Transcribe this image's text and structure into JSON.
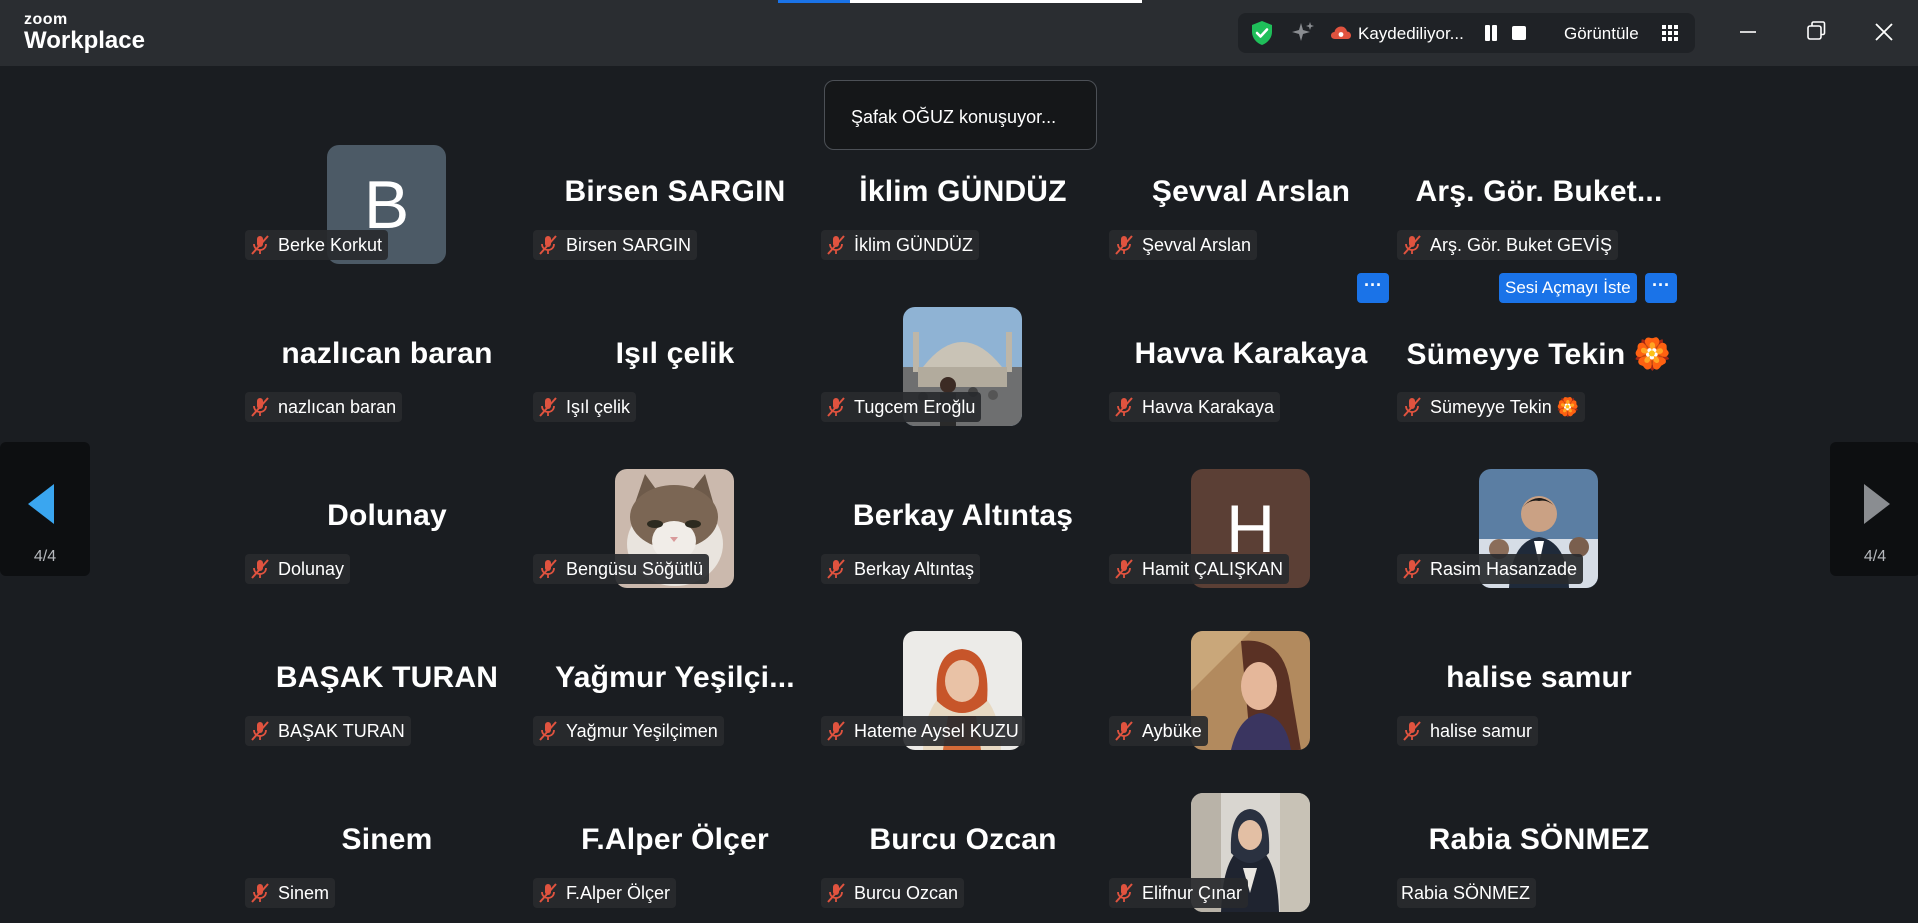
{
  "app": {
    "logo_top": "zoom",
    "logo_bottom": "Workplace"
  },
  "toolbar": {
    "recording_text": "Kaydediliyor...",
    "view_label": "Görüntüle"
  },
  "speaking_banner": "Şafak OĞUZ konuşuyor...",
  "tiles": [
    {
      "display": "",
      "label": "Berke Korkut",
      "avatar": "letter",
      "letter": "B",
      "color": "#4c5a66",
      "muted": true
    },
    {
      "display": "Birsen SARGIN",
      "label": "Birsen SARGIN",
      "avatar": "none",
      "muted": true
    },
    {
      "display": "İklim GÜNDÜZ",
      "label": "İklim GÜNDÜZ",
      "avatar": "none",
      "muted": true
    },
    {
      "display": "Şevval Arslan",
      "label": "Şevval Arslan",
      "avatar": "none",
      "muted": true
    },
    {
      "display": "Arş. Gör. Buket...",
      "label": "Arş. Gör. Buket GEVİŞ",
      "avatar": "none",
      "muted": true
    },
    {
      "display": "nazlıcan baran",
      "label": "nazlıcan baran",
      "avatar": "none",
      "muted": true
    },
    {
      "display": "Işıl çelik",
      "label": "Işıl çelik",
      "avatar": "none",
      "muted": true
    },
    {
      "display": "",
      "label": "Tugcem Eroğlu",
      "avatar": "photo-mosque",
      "muted": true
    },
    {
      "display": "Havva Karakaya",
      "label": "Havva Karakaya",
      "avatar": "none",
      "muted": true
    },
    {
      "display": "Sümeyye  Tekin 🏵️",
      "label": "Sümeyye Tekin 🏵️",
      "avatar": "none",
      "muted": true
    },
    {
      "display": "Dolunay",
      "label": "Dolunay",
      "avatar": "none",
      "muted": true
    },
    {
      "display": "",
      "label": "Bengüsu Söğütlü",
      "avatar": "photo-cat",
      "muted": true
    },
    {
      "display": "Berkay Altıntaş",
      "label": "Berkay Altıntaş",
      "avatar": "none",
      "muted": true
    },
    {
      "display": "",
      "label": "Hamit ÇALIŞKAN",
      "avatar": "letter",
      "letter": "H",
      "color": "#5b3f35",
      "muted": true
    },
    {
      "display": "",
      "label": "Rasim Hasanzade",
      "avatar": "photo-man",
      "muted": true
    },
    {
      "display": "BAŞAK TURAN",
      "label": "BAŞAK TURAN",
      "avatar": "none",
      "muted": true
    },
    {
      "display": "Yağmur  Yeşilçi...",
      "label": "Yağmur Yeşilçimen",
      "avatar": "none",
      "muted": true
    },
    {
      "display": "",
      "label": "Hateme Aysel KUZU",
      "avatar": "photo-hijab",
      "muted": true
    },
    {
      "display": "",
      "label": "Aybüke",
      "avatar": "photo-girl",
      "muted": true
    },
    {
      "display": "halise samur",
      "label": "halise samur",
      "avatar": "none",
      "muted": true
    },
    {
      "display": "Sinem",
      "label": "Sinem",
      "avatar": "none",
      "muted": true
    },
    {
      "display": "F.Alper Ölçer",
      "label": "F.Alper Ölçer",
      "avatar": "none",
      "muted": true
    },
    {
      "display": "Burcu Ozcan",
      "label": "Burcu Ozcan",
      "avatar": "none",
      "muted": true
    },
    {
      "display": "",
      "label": "Elifnur Çınar",
      "avatar": "photo-hijab2",
      "muted": true
    },
    {
      "display": "Rabia SÖNMEZ",
      "label": "Rabia SÖNMEZ",
      "avatar": "none",
      "muted": false
    }
  ],
  "buttons": {
    "more": "···",
    "ask_unmute": "Sesi Açmayı İste"
  },
  "pager": {
    "left": "4/4",
    "right": "4/4"
  },
  "colors": {
    "accent": "#1a73e8",
    "mute_red": "#e0533f",
    "shield": "#1fbf5a",
    "cloud": "#e0533f",
    "bg": "#1a1d21"
  }
}
